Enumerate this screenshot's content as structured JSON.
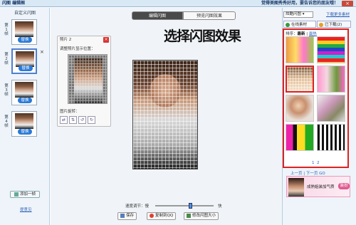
{
  "window": {
    "title": "闪图 编辑框",
    "tagline": "觉得美图秀秀好用，要告诉您的朋友哦！",
    "close": "×"
  },
  "left": {
    "header": "自定义闪图",
    "frames": [
      {
        "label": "第1帧",
        "swap": "替换"
      },
      {
        "label": "第2帧",
        "swap": "替换"
      },
      {
        "label": "第3帧",
        "swap": "替换"
      },
      {
        "label": "第4帧",
        "swap": "替换"
      }
    ],
    "add_frame": "添加一帧",
    "tips": "提意见"
  },
  "center": {
    "tab_edit": "编辑闪图",
    "tab_preview": "预览闪图效果",
    "overlay_text": "选择闪图效果",
    "photo_panel": {
      "title": "照片 2",
      "adjust_label": "调整照片显示位置：",
      "rotate_label": "图片旋转："
    },
    "speed_label": "速度调节：慢",
    "speed_fast": "快",
    "speed_value": 0.6,
    "save_label": "保存",
    "copy_label": "复制到QQ",
    "resize_label": "修改闪图大小"
  },
  "right": {
    "category_select": "炫酷闪图",
    "more_link": "下载更多素材",
    "tab_online": "在线素材",
    "tab_downloaded": "已下载(2)",
    "sort_label": "排序：",
    "sort_latest": "最新",
    "sort_hot": "最热",
    "pages": [
      "1",
      "2"
    ],
    "prev_page": "上一页",
    "next_page": "下一页",
    "nav_extra": "GO",
    "ad_text": "成熟姐装加气质",
    "ad_button": "装扮"
  },
  "colors": {
    "accent_blue": "#2a7ad8",
    "highlight_red": "#dd2222",
    "titlebar": "#d8e8f4",
    "panel_bg": "#eef4fa"
  }
}
